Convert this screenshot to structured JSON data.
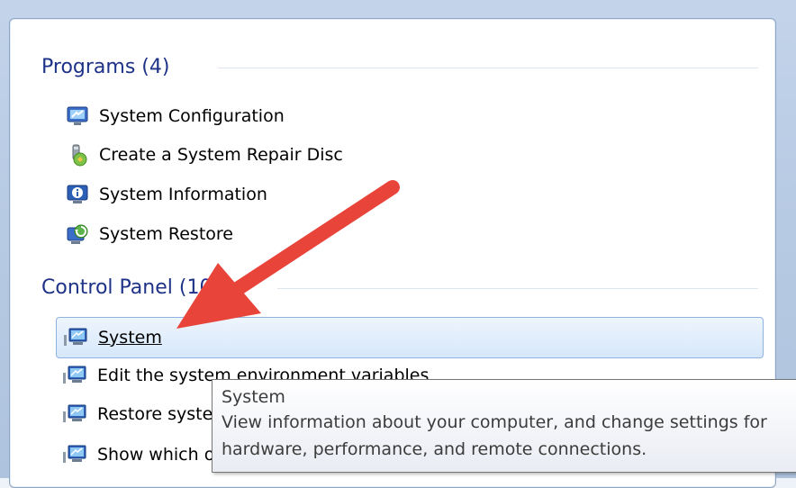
{
  "programs": {
    "header": "Programs (4)",
    "items": [
      {
        "label": "System Configuration",
        "icon": "system-configuration-icon"
      },
      {
        "label": "Create a System Repair Disc",
        "icon": "repair-disc-icon"
      },
      {
        "label": "System Information",
        "icon": "system-information-icon"
      },
      {
        "label": "System Restore",
        "icon": "system-restore-icon"
      }
    ]
  },
  "control_panel": {
    "header": "Control Panel (10)",
    "items": [
      {
        "label": "System",
        "icon": "control-panel-system-icon",
        "selected": true
      },
      {
        "label": "Edit the system environment variables",
        "icon": "control-panel-system-icon"
      },
      {
        "label": "Restore system files and settings from a restore point",
        "icon": "control-panel-system-icon"
      },
      {
        "label": "Show which operating system your computer is running",
        "icon": "control-panel-system-icon"
      }
    ]
  },
  "tooltip": {
    "title": "System",
    "description": "View information about your computer, and change settings for hardware, performance, and remote connections."
  },
  "colors": {
    "header_text": "#1e3287",
    "selection_border": "#8fb3e0",
    "arrow": "#e8443a"
  }
}
